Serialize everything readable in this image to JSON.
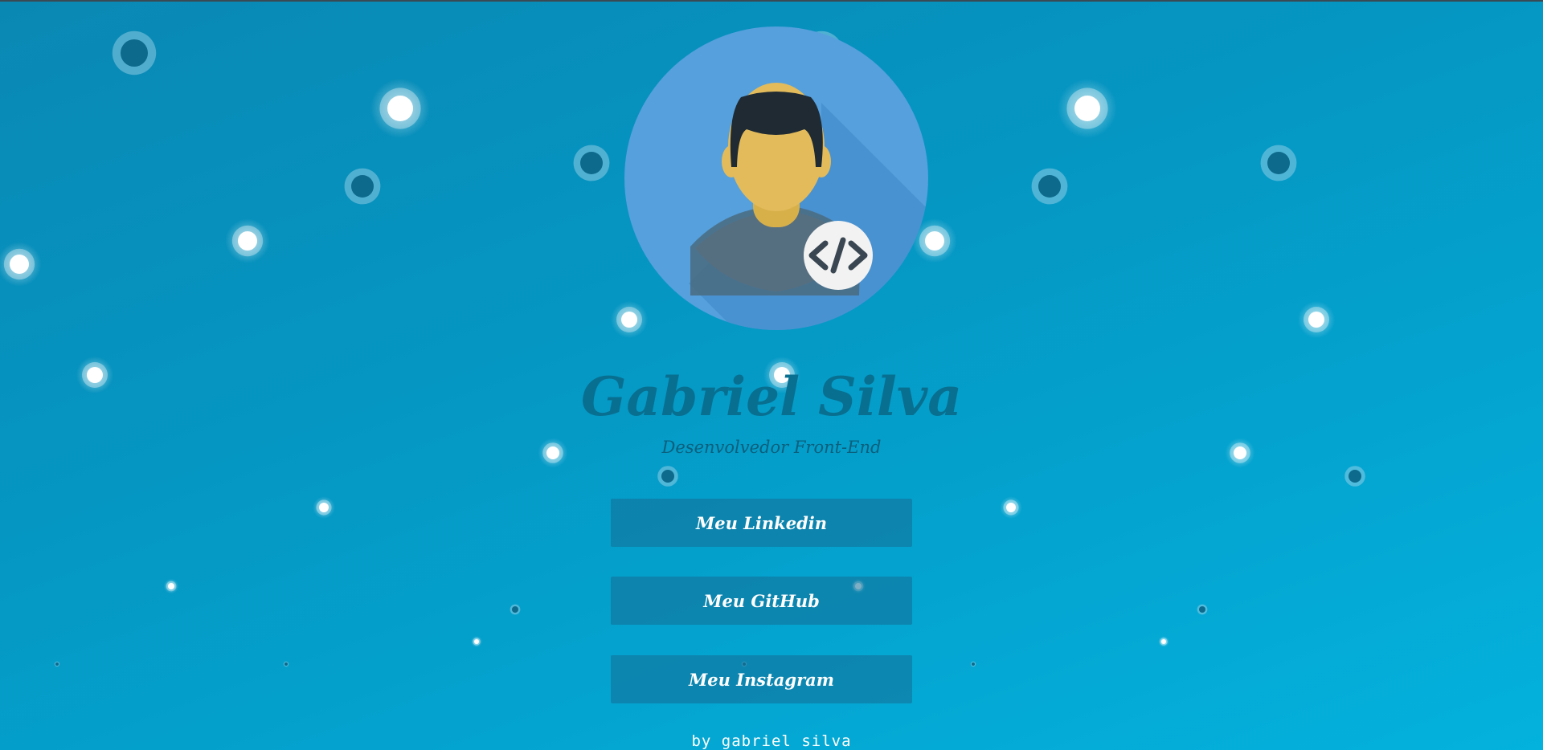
{
  "profile": {
    "name": "Gabriel Silva",
    "role": "Desenvolvedor Front-End"
  },
  "links": [
    {
      "label": "Meu Linkedin"
    },
    {
      "label": "Meu GitHub"
    },
    {
      "label": "Meu Instagram"
    }
  ],
  "footer": {
    "text": "by gabriel silva"
  },
  "icons": {
    "avatar": "developer-avatar-icon",
    "code": "code-brackets-icon"
  },
  "colors": {
    "background": "#0596c2",
    "name_text": "#086f90",
    "button_bg": "#146e96",
    "button_text": "#ffffff",
    "avatar_circle": "#55a0dd",
    "bubble_light": "#ffffff",
    "bubble_dark": "#0d6a8c"
  }
}
